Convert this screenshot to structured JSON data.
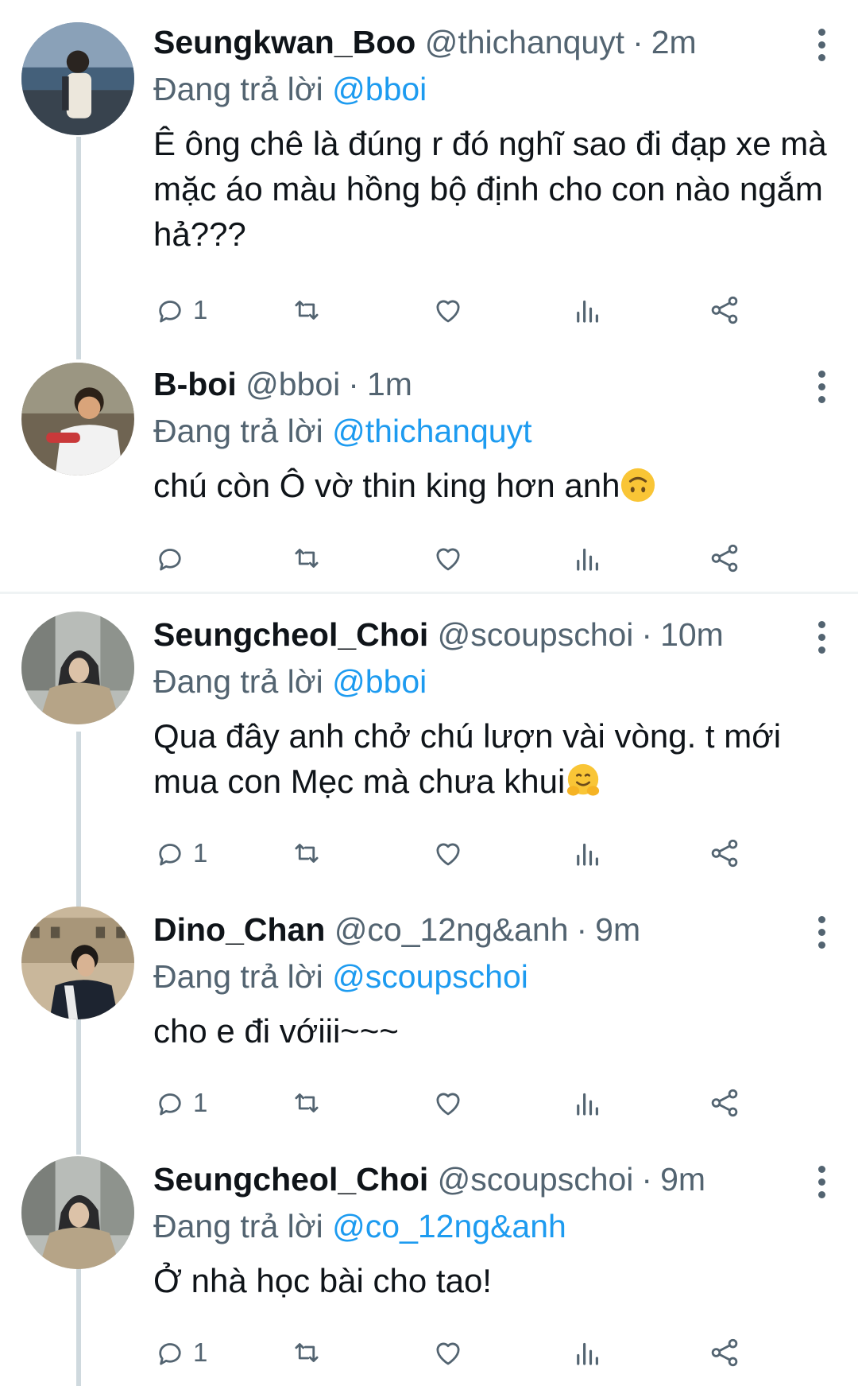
{
  "tweets": [
    {
      "name": "Seungkwan_Boo",
      "handle": "@thichanquyt",
      "dot": "·",
      "time": "2m",
      "replying_prefix": "Đang trả lời",
      "replying_to": "@bboi",
      "text": "Ê ông chê là đúng r đó nghĩ sao đi đạp xe mà mặc áo màu hồng bộ định cho con nào ngắm hả???",
      "reply_count": "1",
      "avatar_icon": "person-beach-photo"
    },
    {
      "name": "B-boi",
      "handle": "@bboi",
      "dot": "·",
      "time": "1m",
      "replying_prefix": "Đang trả lời",
      "replying_to": "@thichanquyt",
      "text": "chú còn Ô vờ thin king hơn anh",
      "emoji": "upside-down-face-emoji",
      "reply_count": "",
      "avatar_icon": "child-photo"
    },
    {
      "name": "Seungcheol_Choi",
      "handle": "@scoupschoi",
      "dot": "·",
      "time": "10m",
      "replying_prefix": "Đang trả lời",
      "replying_to": "@bboi",
      "text": "Qua đây anh chở chú lượn vài vòng. t mới mua con Mẹc mà chưa khui",
      "emoji": "hugging-face-emoji",
      "reply_count": "1",
      "avatar_icon": "hooded-man-photo"
    },
    {
      "name": "Dino_Chan",
      "handle": "@co_12ng&anh",
      "dot": "·",
      "time": "9m",
      "replying_prefix": "Đang trả lời",
      "replying_to": "@scoupschoi",
      "text": "cho e đi vớiii~~~",
      "reply_count": "1",
      "avatar_icon": "man-street-photo"
    },
    {
      "name": "Seungcheol_Choi",
      "handle": "@scoupschoi",
      "dot": "·",
      "time": "9m",
      "replying_prefix": "Đang trả lời",
      "replying_to": "@co_12ng&anh",
      "text": "Ở nhà học bài cho tao!",
      "reply_count": "1",
      "avatar_icon": "hooded-man-photo"
    }
  ],
  "colors": {
    "text": "#0f1419",
    "secondary": "#536471",
    "mention": "#1d9bf0",
    "thread_line": "#cfd9de",
    "divider": "#eff3f4"
  }
}
